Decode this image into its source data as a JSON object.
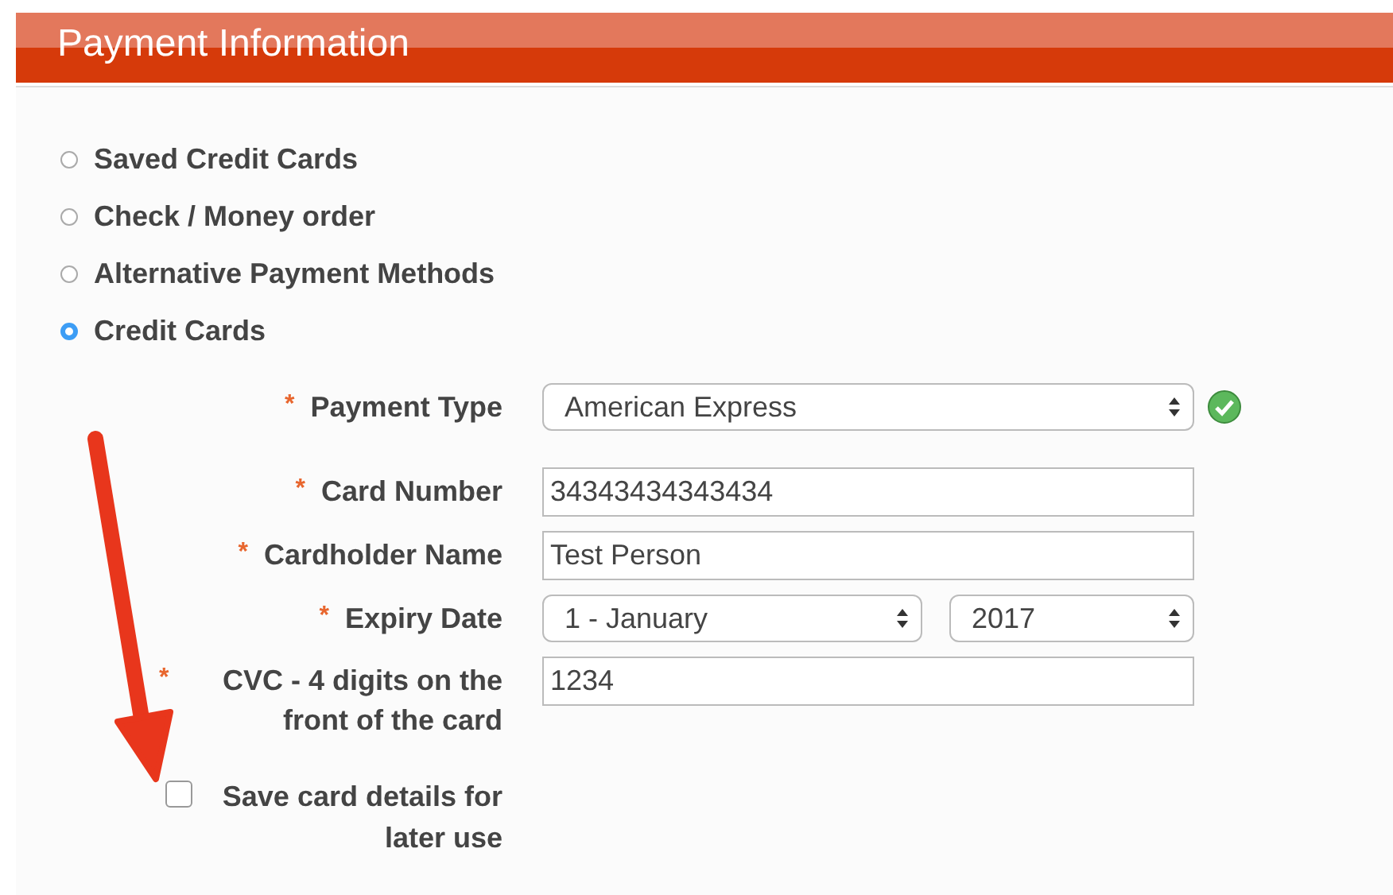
{
  "header": {
    "title": "Payment Information"
  },
  "payment_methods": [
    {
      "label": "Saved Credit Cards",
      "selected": false
    },
    {
      "label": "Check / Money order",
      "selected": false
    },
    {
      "label": "Alternative Payment Methods",
      "selected": false
    },
    {
      "label": "Credit Cards",
      "selected": true
    }
  ],
  "fields": [
    {
      "kind": "select",
      "mark": "*",
      "label": "Payment Type",
      "values": [
        "American Express"
      ],
      "valid": true
    },
    {
      "kind": "text",
      "mark": "*",
      "label": "Card Number",
      "values": [
        "34343434343434"
      ],
      "valid": false
    },
    {
      "kind": "text",
      "mark": "*",
      "label": "Cardholder Name",
      "values": [
        "Test Person"
      ],
      "valid": false
    },
    {
      "kind": "date",
      "mark": "*",
      "label": "Expiry Date",
      "values": [
        "1 - January",
        "2017"
      ],
      "valid": false
    },
    {
      "kind": "text",
      "mark": "*",
      "label": "CVC - 4 digits on the front of the card",
      "values": [
        "1234"
      ],
      "valid": false
    }
  ],
  "save_card": {
    "label": "Save card details for later use",
    "checked": false
  }
}
